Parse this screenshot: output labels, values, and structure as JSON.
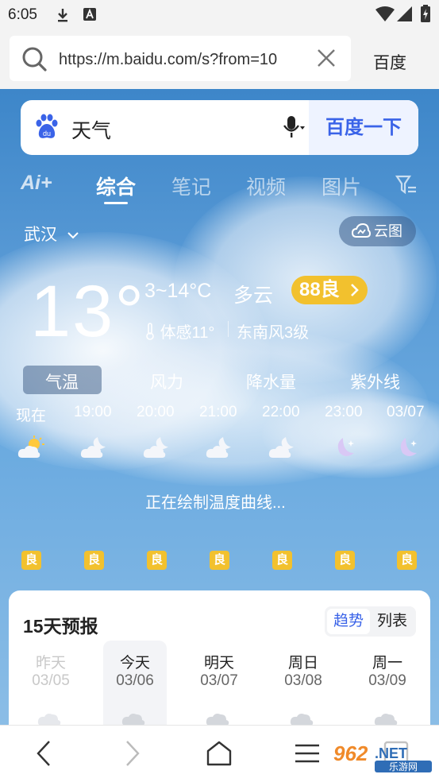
{
  "status": {
    "time": "6:05"
  },
  "browser": {
    "url": "https://m.baidu.com/s?from=10",
    "right_label": "百度"
  },
  "search": {
    "query": "天气",
    "button": "百度一下"
  },
  "tabs": {
    "ai": "Ai+",
    "items": [
      "综合",
      "笔记",
      "视频",
      "图片"
    ]
  },
  "location": {
    "city": "武汉",
    "cloud_map": "云图"
  },
  "current": {
    "temp": "13°",
    "range": "3~14°C",
    "condition": "多云",
    "aqi": "88良",
    "feels_like": "体感11°",
    "wind": "东南风3级"
  },
  "subtabs": [
    "气温",
    "风力",
    "降水量",
    "紫外线"
  ],
  "hourly": [
    {
      "time": "现在",
      "icon": "partly-cloudy-day-icon",
      "aq": "良"
    },
    {
      "time": "19:00",
      "icon": "cloudy-night-icon",
      "aq": "良"
    },
    {
      "time": "20:00",
      "icon": "cloudy-night-icon",
      "aq": "良"
    },
    {
      "time": "21:00",
      "icon": "cloudy-night-icon",
      "aq": "良"
    },
    {
      "time": "22:00",
      "icon": "cloudy-night-icon",
      "aq": "良"
    },
    {
      "time": "23:00",
      "icon": "clear-night-icon",
      "aq": "良"
    },
    {
      "time": "03/07",
      "icon": "clear-night-icon",
      "aq": "良"
    }
  ],
  "loading_text": "正在绘制温度曲线...",
  "forecast": {
    "title": "15天预报",
    "toggle": {
      "trend": "趋势",
      "list": "列表"
    },
    "days": [
      {
        "day": "昨天",
        "date": "03/05"
      },
      {
        "day": "今天",
        "date": "03/06"
      },
      {
        "day": "明天",
        "date": "03/07"
      },
      {
        "day": "周日",
        "date": "03/08"
      },
      {
        "day": "周一",
        "date": "03/09"
      }
    ]
  },
  "colors": {
    "accent_blue": "#3a63e8",
    "aqi_yellow": "#f2c12e",
    "sky_top": "#3d86c9"
  }
}
